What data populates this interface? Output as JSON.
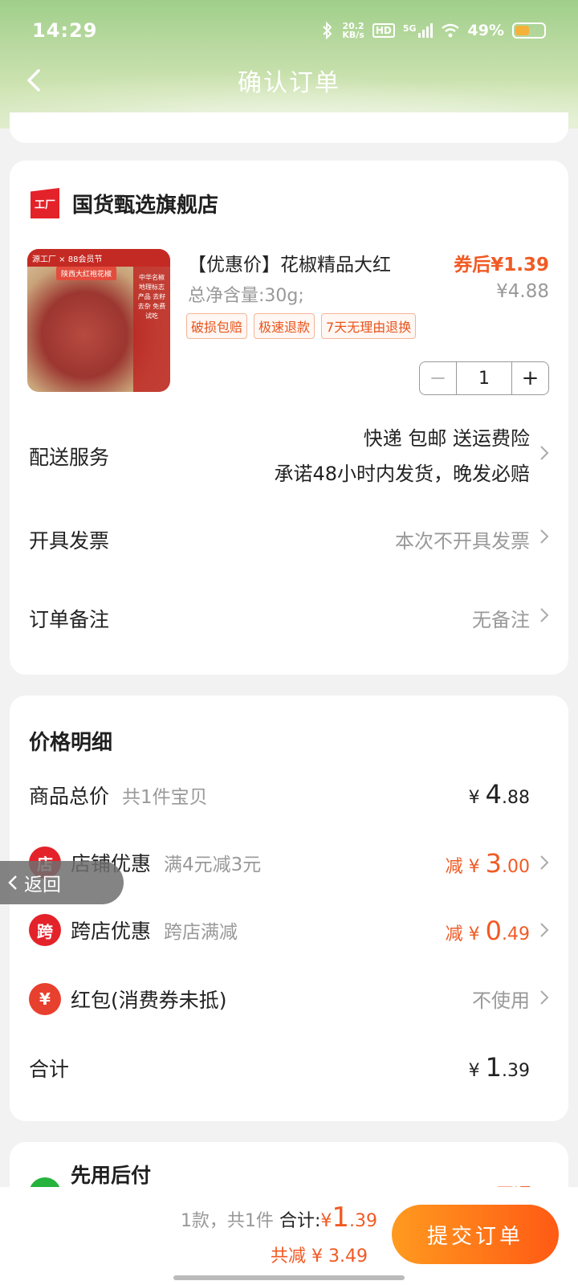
{
  "status_bar": {
    "time": "14:29",
    "net_speed_value": "20.2",
    "net_speed_unit": "KB/s",
    "hd": "HD",
    "network": "5G",
    "battery": "49%",
    "battery_level": 0.49
  },
  "nav": {
    "title": "确认订单"
  },
  "shop": {
    "logo_text": "工厂",
    "name": "国货甄选旗舰店",
    "product": {
      "title": "【优惠价】花椒精品大红",
      "spec": "总净含量:30g;",
      "price_after_coupon": "券后¥1.39",
      "original_price": "¥4.88",
      "tags": [
        "破损包赔",
        "极速退款",
        "7天无理由退换"
      ],
      "quantity": "1",
      "image": {
        "banner": "源工厂 × 88会员节",
        "label": "陕西大红袍花椒",
        "side_text": "中华名椒 地理标志产品 去籽去杂 免费试吃"
      }
    },
    "rows": {
      "delivery_label": "配送服务",
      "delivery_line1": "快递 包邮 送运费险",
      "delivery_line2": "承诺48小时内发货，晚发必赔",
      "invoice_label": "开具发票",
      "invoice_value": "本次不开具发票",
      "remark_label": "订单备注",
      "remark_value": "无备注"
    }
  },
  "price_detail": {
    "title": "价格明细",
    "total_goods_label": "商品总价",
    "total_goods_sub": "共1件宝贝",
    "total_goods_currency": "¥",
    "total_goods_int": "4",
    "total_goods_dec": ".88",
    "shop_discount_icon": "店",
    "shop_discount_label": "店铺优惠",
    "shop_discount_sub": "满4元减3元",
    "shop_discount_prefix": "减 ¥",
    "shop_discount_int": "3",
    "shop_discount_dec": ".00",
    "cross_discount_icon": "跨",
    "cross_discount_label": "跨店优惠",
    "cross_discount_sub": "跨店满减",
    "cross_discount_prefix": "减 ¥",
    "cross_discount_int": "0",
    "cross_discount_dec": ".49",
    "redpacket_icon": "¥",
    "redpacket_label": "红包(消费券未抵)",
    "redpacket_value": "不使用",
    "sum_label": "合计",
    "sum_currency": "¥",
    "sum_int": "1",
    "sum_dec": ".39"
  },
  "floating_back": {
    "label": "返回"
  },
  "pay_later": {
    "title": "先用后付",
    "action": "开通 ›"
  },
  "bottom": {
    "count_text": "1款，共1件",
    "total_label": "合计:",
    "total_currency": "¥",
    "total_int": "1",
    "total_dec": ".39",
    "save_text": "共减 ¥ 3.49",
    "submit_label": "提交订单"
  },
  "colors": {
    "accent": "#f15a24",
    "submit_gradient_start": "#ff9a1f",
    "submit_gradient_end": "#ff5a14",
    "shop_logo": "#e4222a"
  }
}
